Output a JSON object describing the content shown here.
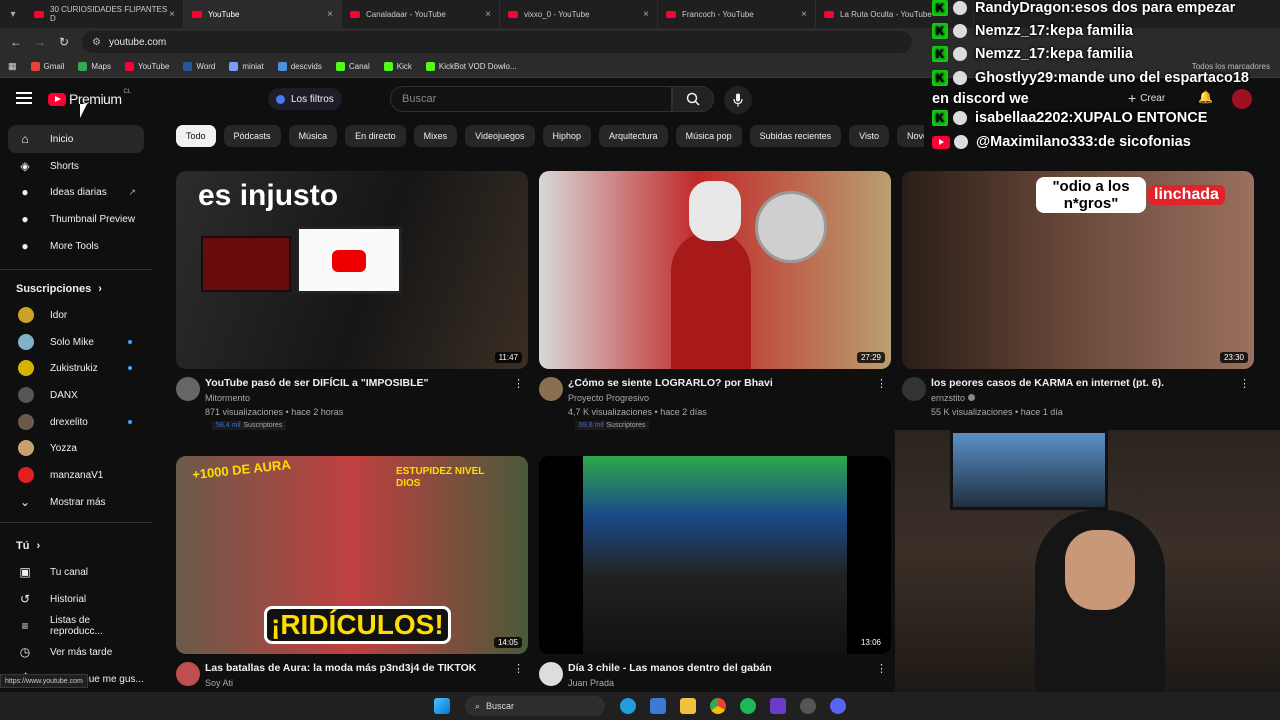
{
  "browser": {
    "tabs": [
      {
        "label": "30 CURIOSIDADES FLIPANTES D"
      },
      {
        "label": "YouTube"
      },
      {
        "label": "Canaladaar - YouTube"
      },
      {
        "label": "vixxo_0 - YouTube"
      },
      {
        "label": "Francoch - YouTube"
      },
      {
        "label": "La Ruta Oculta - YouTube"
      }
    ],
    "url": "youtube.com",
    "bookmarks": [
      {
        "label": "Gmail",
        "color": "#ea4335"
      },
      {
        "label": "Maps",
        "color": "#34a853"
      },
      {
        "label": "YouTube",
        "color": "#ff0033"
      },
      {
        "label": "Word",
        "color": "#2b579a"
      },
      {
        "label": "miniat",
        "color": "#7a9cff"
      },
      {
        "label": "descvids",
        "color": "#4a90e2"
      },
      {
        "label": "Canal",
        "color": "#53fc18"
      },
      {
        "label": "Kick",
        "color": "#53fc18"
      },
      {
        "label": "KickBot VOD Dowlo...",
        "color": "#53fc18"
      }
    ],
    "all_bookmarks": "Todos los marcadores",
    "status_url": "https://www.youtube.com"
  },
  "header": {
    "logo_text": "Premium",
    "country": "CL",
    "filters_label": "Los filtros",
    "search_placeholder": "Buscar",
    "create_label": "Crear"
  },
  "sidebar": {
    "main": [
      {
        "label": "Inicio",
        "icon": "home-icon"
      },
      {
        "label": "Shorts",
        "icon": "shorts-icon"
      },
      {
        "label": "Ideas diarias",
        "icon": "ideas-icon"
      },
      {
        "label": "Thumbnail Preview",
        "icon": "thumbnail-icon"
      },
      {
        "label": "More Tools",
        "icon": "tools-icon"
      }
    ],
    "subs_title": "Suscripciones",
    "subs": [
      {
        "label": "Idor",
        "color": "#c9a227",
        "dot": false
      },
      {
        "label": "Solo Mike",
        "color": "#7fb2c9",
        "dot": true
      },
      {
        "label": "Zukistrukiz",
        "color": "#d4b400",
        "dot": true
      },
      {
        "label": "DANX",
        "color": "#555555",
        "dot": false
      },
      {
        "label": "drexelito",
        "color": "#6a5a4a",
        "dot": true
      },
      {
        "label": "Yozza",
        "color": "#c9a070",
        "dot": false
      },
      {
        "label": "manzanaV1",
        "color": "#e02020",
        "dot": false
      }
    ],
    "show_more": "Mostrar más",
    "you_title": "Tú",
    "you": [
      {
        "label": "Tu canal",
        "icon": "channel-icon"
      },
      {
        "label": "Historial",
        "icon": "history-icon"
      },
      {
        "label": "Listas de reproducc...",
        "icon": "playlist-icon"
      },
      {
        "label": "Ver más tarde",
        "icon": "watch-later-icon"
      },
      {
        "label": "Videos que me gus...",
        "icon": "like-icon"
      }
    ]
  },
  "chips": [
    "Todo",
    "Pódcasts",
    "Música",
    "En directo",
    "Mixes",
    "Videojuegos",
    "Hiphop",
    "Arquitectura",
    "Música pop",
    "Subidas recientes",
    "Visto",
    "Novedad para ti"
  ],
  "videos": [
    {
      "title": "YouTube pasó de ser DIFÍCIL a \"IMPOSIBLE\"",
      "channel": "Mitormento",
      "meta": "871 visualizaciones • hace 2 horas",
      "subs_num": "58,4 mil",
      "subs_label": "Suscriptores",
      "duration": "11:47",
      "thumb_text": "es injusto",
      "avatar": "#666666",
      "verified": false
    },
    {
      "title": "¿Cómo se siente LOGRARLO? por Bhavi",
      "channel": "Proyecto Progresivo",
      "meta": "4,7 K visualizaciones • hace 2 días",
      "subs_num": "69,8 mil",
      "subs_label": "Suscriptores",
      "duration": "27:29",
      "thumb_text": "",
      "avatar": "#8a7050",
      "verified": false
    },
    {
      "title": "los peores casos de KARMA en internet (pt. 6).",
      "channel": "ernzstito",
      "meta": "55 K visualizaciones • hace 1 día",
      "subs_num": "",
      "subs_label": "",
      "duration": "23:30",
      "thumb_text": "\"odio a los n*gros\"",
      "thumb_text2": "linchada",
      "avatar": "#333333",
      "verified": true
    },
    {
      "title": "Las batallas de Aura: la moda más p3nd3j4 de TIKTOK",
      "channel": "Soy Ati",
      "meta": "",
      "subs_num": "",
      "subs_label": "",
      "duration": "14:05",
      "thumb_text": "¡RIDÍCULOS!",
      "thumb_text2": "+1000 DE AURA",
      "thumb_text3": "ESTUPIDEZ NIVEL DIOS",
      "avatar": "#c05050",
      "verified": false
    },
    {
      "title": "Día 3 chile - Las manos dentro del gabán",
      "channel": "Juan Prada",
      "meta": "",
      "subs_num": "",
      "subs_label": "",
      "duration": "13:06",
      "thumb_text": "",
      "avatar": "#dddddd",
      "verified": false
    }
  ],
  "chat": [
    {
      "user": "RandyDragon",
      "message": "esos dos para empezar",
      "badge": "kick"
    },
    {
      "user": "Nemzz_17",
      "message": "kepa familia",
      "badge": "kick"
    },
    {
      "user": "Nemzz_17",
      "message": "kepa familia",
      "badge": "kick"
    },
    {
      "user": "Ghostlyy29",
      "message": "mande uno del espartaco18",
      "badge": "kick"
    },
    {
      "user": "",
      "message": "en discord we",
      "badge": ""
    },
    {
      "user": "isabellaa2202",
      "message": "XUPALO ENTONCE",
      "badge": "kick"
    },
    {
      "user": "@Maximilano333",
      "message": "de sicofonias",
      "badge": "youtube"
    }
  ],
  "taskbar": {
    "search_label": "Buscar"
  }
}
